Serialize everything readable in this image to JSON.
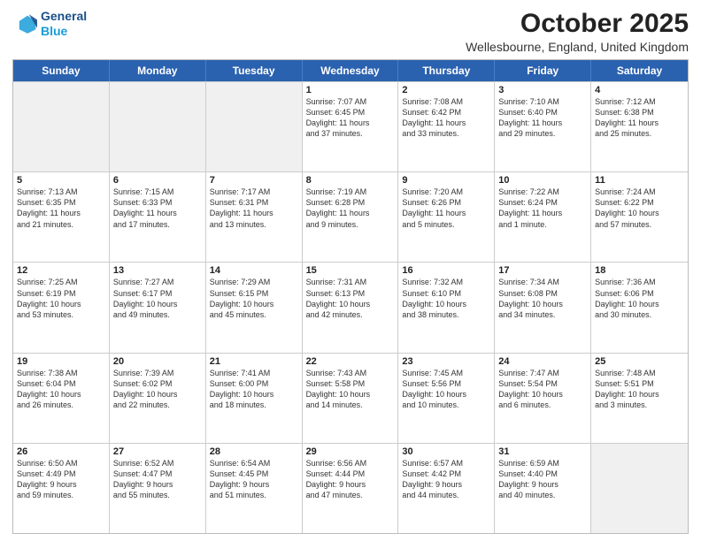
{
  "logo": {
    "line1": "General",
    "line2": "Blue"
  },
  "title": "October 2025",
  "subtitle": "Wellesbourne, England, United Kingdom",
  "days": [
    "Sunday",
    "Monday",
    "Tuesday",
    "Wednesday",
    "Thursday",
    "Friday",
    "Saturday"
  ],
  "rows": [
    [
      {
        "day": "",
        "info": "",
        "shaded": true
      },
      {
        "day": "",
        "info": "",
        "shaded": true
      },
      {
        "day": "",
        "info": "",
        "shaded": true
      },
      {
        "day": "1",
        "info": "Sunrise: 7:07 AM\nSunset: 6:45 PM\nDaylight: 11 hours\nand 37 minutes.",
        "shaded": false
      },
      {
        "day": "2",
        "info": "Sunrise: 7:08 AM\nSunset: 6:42 PM\nDaylight: 11 hours\nand 33 minutes.",
        "shaded": false
      },
      {
        "day": "3",
        "info": "Sunrise: 7:10 AM\nSunset: 6:40 PM\nDaylight: 11 hours\nand 29 minutes.",
        "shaded": false
      },
      {
        "day": "4",
        "info": "Sunrise: 7:12 AM\nSunset: 6:38 PM\nDaylight: 11 hours\nand 25 minutes.",
        "shaded": false
      }
    ],
    [
      {
        "day": "5",
        "info": "Sunrise: 7:13 AM\nSunset: 6:35 PM\nDaylight: 11 hours\nand 21 minutes.",
        "shaded": false
      },
      {
        "day": "6",
        "info": "Sunrise: 7:15 AM\nSunset: 6:33 PM\nDaylight: 11 hours\nand 17 minutes.",
        "shaded": false
      },
      {
        "day": "7",
        "info": "Sunrise: 7:17 AM\nSunset: 6:31 PM\nDaylight: 11 hours\nand 13 minutes.",
        "shaded": false
      },
      {
        "day": "8",
        "info": "Sunrise: 7:19 AM\nSunset: 6:28 PM\nDaylight: 11 hours\nand 9 minutes.",
        "shaded": false
      },
      {
        "day": "9",
        "info": "Sunrise: 7:20 AM\nSunset: 6:26 PM\nDaylight: 11 hours\nand 5 minutes.",
        "shaded": false
      },
      {
        "day": "10",
        "info": "Sunrise: 7:22 AM\nSunset: 6:24 PM\nDaylight: 11 hours\nand 1 minute.",
        "shaded": false
      },
      {
        "day": "11",
        "info": "Sunrise: 7:24 AM\nSunset: 6:22 PM\nDaylight: 10 hours\nand 57 minutes.",
        "shaded": false
      }
    ],
    [
      {
        "day": "12",
        "info": "Sunrise: 7:25 AM\nSunset: 6:19 PM\nDaylight: 10 hours\nand 53 minutes.",
        "shaded": false
      },
      {
        "day": "13",
        "info": "Sunrise: 7:27 AM\nSunset: 6:17 PM\nDaylight: 10 hours\nand 49 minutes.",
        "shaded": false
      },
      {
        "day": "14",
        "info": "Sunrise: 7:29 AM\nSunset: 6:15 PM\nDaylight: 10 hours\nand 45 minutes.",
        "shaded": false
      },
      {
        "day": "15",
        "info": "Sunrise: 7:31 AM\nSunset: 6:13 PM\nDaylight: 10 hours\nand 42 minutes.",
        "shaded": false
      },
      {
        "day": "16",
        "info": "Sunrise: 7:32 AM\nSunset: 6:10 PM\nDaylight: 10 hours\nand 38 minutes.",
        "shaded": false
      },
      {
        "day": "17",
        "info": "Sunrise: 7:34 AM\nSunset: 6:08 PM\nDaylight: 10 hours\nand 34 minutes.",
        "shaded": false
      },
      {
        "day": "18",
        "info": "Sunrise: 7:36 AM\nSunset: 6:06 PM\nDaylight: 10 hours\nand 30 minutes.",
        "shaded": false
      }
    ],
    [
      {
        "day": "19",
        "info": "Sunrise: 7:38 AM\nSunset: 6:04 PM\nDaylight: 10 hours\nand 26 minutes.",
        "shaded": false
      },
      {
        "day": "20",
        "info": "Sunrise: 7:39 AM\nSunset: 6:02 PM\nDaylight: 10 hours\nand 22 minutes.",
        "shaded": false
      },
      {
        "day": "21",
        "info": "Sunrise: 7:41 AM\nSunset: 6:00 PM\nDaylight: 10 hours\nand 18 minutes.",
        "shaded": false
      },
      {
        "day": "22",
        "info": "Sunrise: 7:43 AM\nSunset: 5:58 PM\nDaylight: 10 hours\nand 14 minutes.",
        "shaded": false
      },
      {
        "day": "23",
        "info": "Sunrise: 7:45 AM\nSunset: 5:56 PM\nDaylight: 10 hours\nand 10 minutes.",
        "shaded": false
      },
      {
        "day": "24",
        "info": "Sunrise: 7:47 AM\nSunset: 5:54 PM\nDaylight: 10 hours\nand 6 minutes.",
        "shaded": false
      },
      {
        "day": "25",
        "info": "Sunrise: 7:48 AM\nSunset: 5:51 PM\nDaylight: 10 hours\nand 3 minutes.",
        "shaded": false
      }
    ],
    [
      {
        "day": "26",
        "info": "Sunrise: 6:50 AM\nSunset: 4:49 PM\nDaylight: 9 hours\nand 59 minutes.",
        "shaded": false
      },
      {
        "day": "27",
        "info": "Sunrise: 6:52 AM\nSunset: 4:47 PM\nDaylight: 9 hours\nand 55 minutes.",
        "shaded": false
      },
      {
        "day": "28",
        "info": "Sunrise: 6:54 AM\nSunset: 4:45 PM\nDaylight: 9 hours\nand 51 minutes.",
        "shaded": false
      },
      {
        "day": "29",
        "info": "Sunrise: 6:56 AM\nSunset: 4:44 PM\nDaylight: 9 hours\nand 47 minutes.",
        "shaded": false
      },
      {
        "day": "30",
        "info": "Sunrise: 6:57 AM\nSunset: 4:42 PM\nDaylight: 9 hours\nand 44 minutes.",
        "shaded": false
      },
      {
        "day": "31",
        "info": "Sunrise: 6:59 AM\nSunset: 4:40 PM\nDaylight: 9 hours\nand 40 minutes.",
        "shaded": false
      },
      {
        "day": "",
        "info": "",
        "shaded": true
      }
    ]
  ]
}
